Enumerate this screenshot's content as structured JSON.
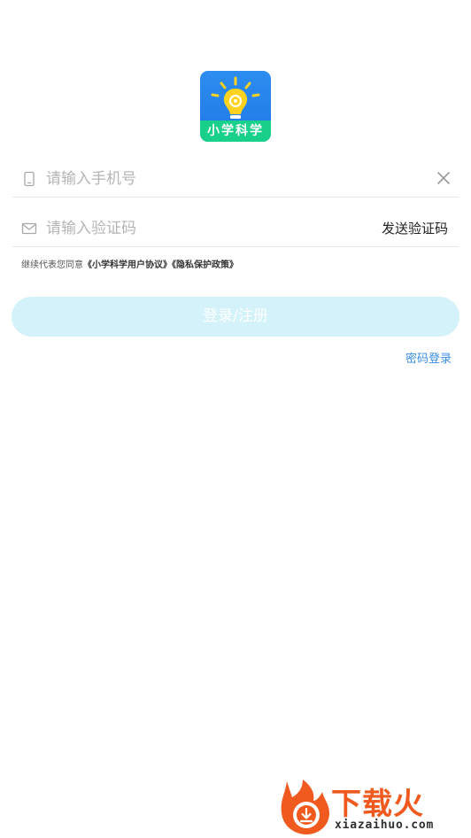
{
  "app": {
    "logo_text": "小学科学",
    "logo_icon": "lightbulb-icon",
    "colors": {
      "logo_blue": "#2c8df0",
      "logo_green": "#19d08a",
      "bulb_yellow": "#ffd21f"
    }
  },
  "form": {
    "phone": {
      "placeholder": "请输入手机号",
      "value": "",
      "icon": "phone-icon",
      "clear_icon": "close-icon"
    },
    "code": {
      "placeholder": "请输入验证码",
      "value": "",
      "icon": "mail-icon",
      "send_label": "发送验证码"
    },
    "agreement": {
      "prefix": "继续代表您同意",
      "user_agreement": "《小学科学用户协议》",
      "privacy_policy": "《隐私保护政策》"
    },
    "submit_label": "登录/注册",
    "submit_color": "#d4f2fa",
    "password_login_label": "密码登录",
    "link_color": "#3a8ee6"
  },
  "watermark": {
    "brand": "下载火",
    "domain": "xiazaihuo.com",
    "icon": "flame-download-icon",
    "color": "#f05a1f"
  }
}
